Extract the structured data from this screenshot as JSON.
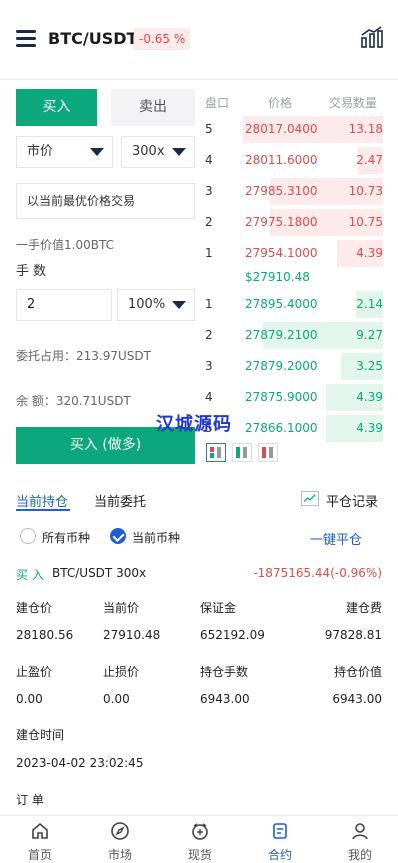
{
  "header": {
    "pair": "BTC/USDT",
    "change": "-0.65 %"
  },
  "trade": {
    "tab_buy": "买入",
    "tab_sell": "卖出",
    "order_type": "市价",
    "leverage": "300x",
    "price_field": "以当前最优价格交易",
    "lot_value": "一手价值1.00BTC",
    "qty_label": "手 数",
    "qty_value": "2",
    "percent": "100%",
    "margin_used": "委托占用：213.97USDT",
    "balance": "余 额：320.71USDT",
    "submit": "买入 (做多)"
  },
  "orderbook": {
    "headers": [
      "盘口",
      "价格",
      "交易数量"
    ],
    "asks": [
      {
        "level": "5",
        "price": "28017.0400",
        "qty": "13.18",
        "depth": 1.0
      },
      {
        "level": "4",
        "price": "28011.6000",
        "qty": "2.47",
        "depth": 0.18
      },
      {
        "level": "3",
        "price": "27985.3100",
        "qty": "10.73",
        "depth": 0.81
      },
      {
        "level": "2",
        "price": "27975.1800",
        "qty": "10.75",
        "depth": 0.81
      },
      {
        "level": "1",
        "price": "27954.1000",
        "qty": "4.39",
        "depth": 0.33
      }
    ],
    "mid_price": "$27910.48",
    "bids": [
      {
        "level": "1",
        "price": "27895.4000",
        "qty": "2.14",
        "depth": 0.19
      },
      {
        "level": "2",
        "price": "27879.2100",
        "qty": "9.27",
        "depth": 0.86
      },
      {
        "level": "3",
        "price": "27879.2000",
        "qty": "3.25",
        "depth": 0.3
      },
      {
        "level": "4",
        "price": "27875.9000",
        "qty": "4.39",
        "depth": 0.41
      },
      {
        "level": "5",
        "price": "27866.1000",
        "qty": "4.39",
        "depth": 0.41
      }
    ]
  },
  "watermark": "汉城源码",
  "positions": {
    "tab_current": "当前持仓",
    "tab_orders": "当前委托",
    "records": "平仓记录",
    "filter_all": "所有币种",
    "filter_current": "当前币种",
    "close_all": "一键平仓",
    "side": "买 入",
    "pair": "BTC/USDT 300x",
    "pnl": "-1875165.44(-0.96%)",
    "stats": [
      {
        "k": "建仓价",
        "v": "28180.56"
      },
      {
        "k": "当前价",
        "v": "27910.48"
      },
      {
        "k": "保证金",
        "v": "652192.09"
      },
      {
        "k": "建仓费",
        "v": "97828.81"
      },
      {
        "k": "止盈价",
        "v": "0.00"
      },
      {
        "k": "止损价",
        "v": "0.00"
      },
      {
        "k": "持仓手数",
        "v": "6943.00"
      },
      {
        "k": "持仓价值",
        "v": "6943.00"
      }
    ],
    "open_time_label": "建仓时间",
    "open_time": "2023-04-02 23:02:45",
    "order_label": "订 单"
  },
  "nav": [
    {
      "label": "首页",
      "icon": "home-icon"
    },
    {
      "label": "市场",
      "icon": "compass-icon"
    },
    {
      "label": "现货",
      "icon": "spot-icon"
    },
    {
      "label": "合约",
      "icon": "contract-icon"
    },
    {
      "label": "我的",
      "icon": "profile-icon"
    }
  ],
  "colors": {
    "green": "#0aa87a",
    "red": "#e04a4a",
    "blue": "#1f5fcf"
  }
}
